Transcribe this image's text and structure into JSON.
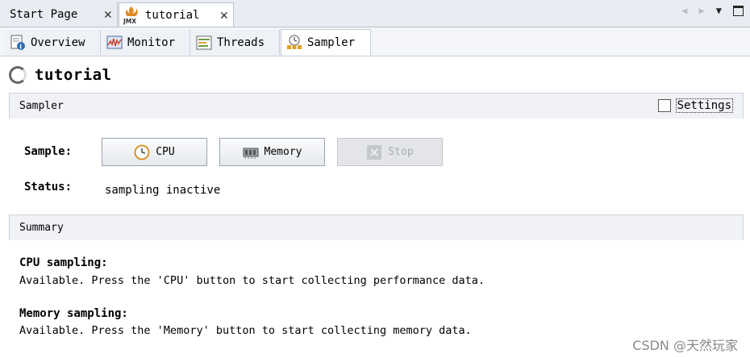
{
  "doc_tabs": [
    {
      "label": "Start Page",
      "close": "✕"
    },
    {
      "label": "tutorial",
      "close": "✕"
    }
  ],
  "view_tabs": [
    {
      "label": "Overview"
    },
    {
      "label": "Monitor"
    },
    {
      "label": "Threads"
    },
    {
      "label": "Sampler"
    }
  ],
  "page_title": "tutorial",
  "sampler_section": {
    "title": "Sampler",
    "settings_label": "Settings",
    "sample_label": "Sample:",
    "buttons": {
      "cpu": "CPU",
      "memory": "Memory",
      "stop": "Stop"
    },
    "status_label": "Status:",
    "status_value": "sampling inactive"
  },
  "summary_section": {
    "title": "Summary",
    "cpu_heading": "CPU sampling:",
    "cpu_text": "Available. Press the 'CPU' button to start collecting performance data.",
    "memory_heading": "Memory sampling:",
    "memory_text": "Available. Press the 'Memory' button to start collecting memory data."
  },
  "watermark": "CSDN @天然玩家",
  "icons": {
    "doc_tab": "jmx-icon",
    "overview": "overview-icon",
    "monitor": "monitor-icon",
    "threads": "threads-icon",
    "sampler": "sampler-icon",
    "cpu": "clock-icon",
    "memory": "memory-chip-icon",
    "stop": "stop-icon"
  },
  "colors": {
    "accent_blue": "#2b6cb8",
    "section_bg": "#f0f2f5",
    "tab_bg": "#e9edf3"
  }
}
